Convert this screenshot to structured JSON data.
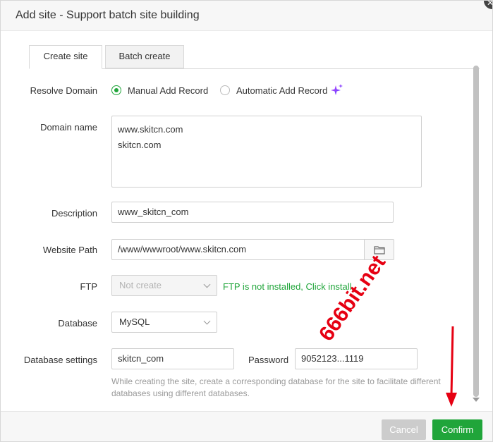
{
  "dialog": {
    "title": "Add site - Support batch site building",
    "close_symbol": "✕"
  },
  "tabs": [
    {
      "label": "Create site",
      "active": true
    },
    {
      "label": "Batch create",
      "active": false
    }
  ],
  "resolve_domain": {
    "label": "Resolve Domain",
    "options": [
      {
        "label": "Manual Add Record",
        "selected": true
      },
      {
        "label": "Automatic Add Record",
        "selected": false
      }
    ],
    "sparkle_icon": "sparkle-icon"
  },
  "domain_name": {
    "label": "Domain name",
    "lines": [
      "www.skitcn.com",
      "skitcn.com"
    ]
  },
  "description": {
    "label": "Description",
    "value": "www_skitcn_com"
  },
  "website_path": {
    "label": "Website Path",
    "value": "/www/wwwroot/www.skitcn.com",
    "folder_icon": "folder-icon"
  },
  "ftp": {
    "label": "FTP",
    "selected": "Not create",
    "notice": "FTP is not installed, Click install"
  },
  "database": {
    "label": "Database",
    "selected": "MySQL"
  },
  "database_settings": {
    "label": "Database settings",
    "name_value": "skitcn_com",
    "password_label": "Password",
    "password_value": "9052123...1119",
    "help_text": "While creating the site, create a corresponding database for the site to facilitate different databases using different databases."
  },
  "footer": {
    "cancel_label": "Cancel",
    "confirm_label": "Confirm"
  },
  "watermark": {
    "text": "666bit.net"
  },
  "colors": {
    "accent": "#20a53a",
    "annotation_red": "#e60012"
  }
}
